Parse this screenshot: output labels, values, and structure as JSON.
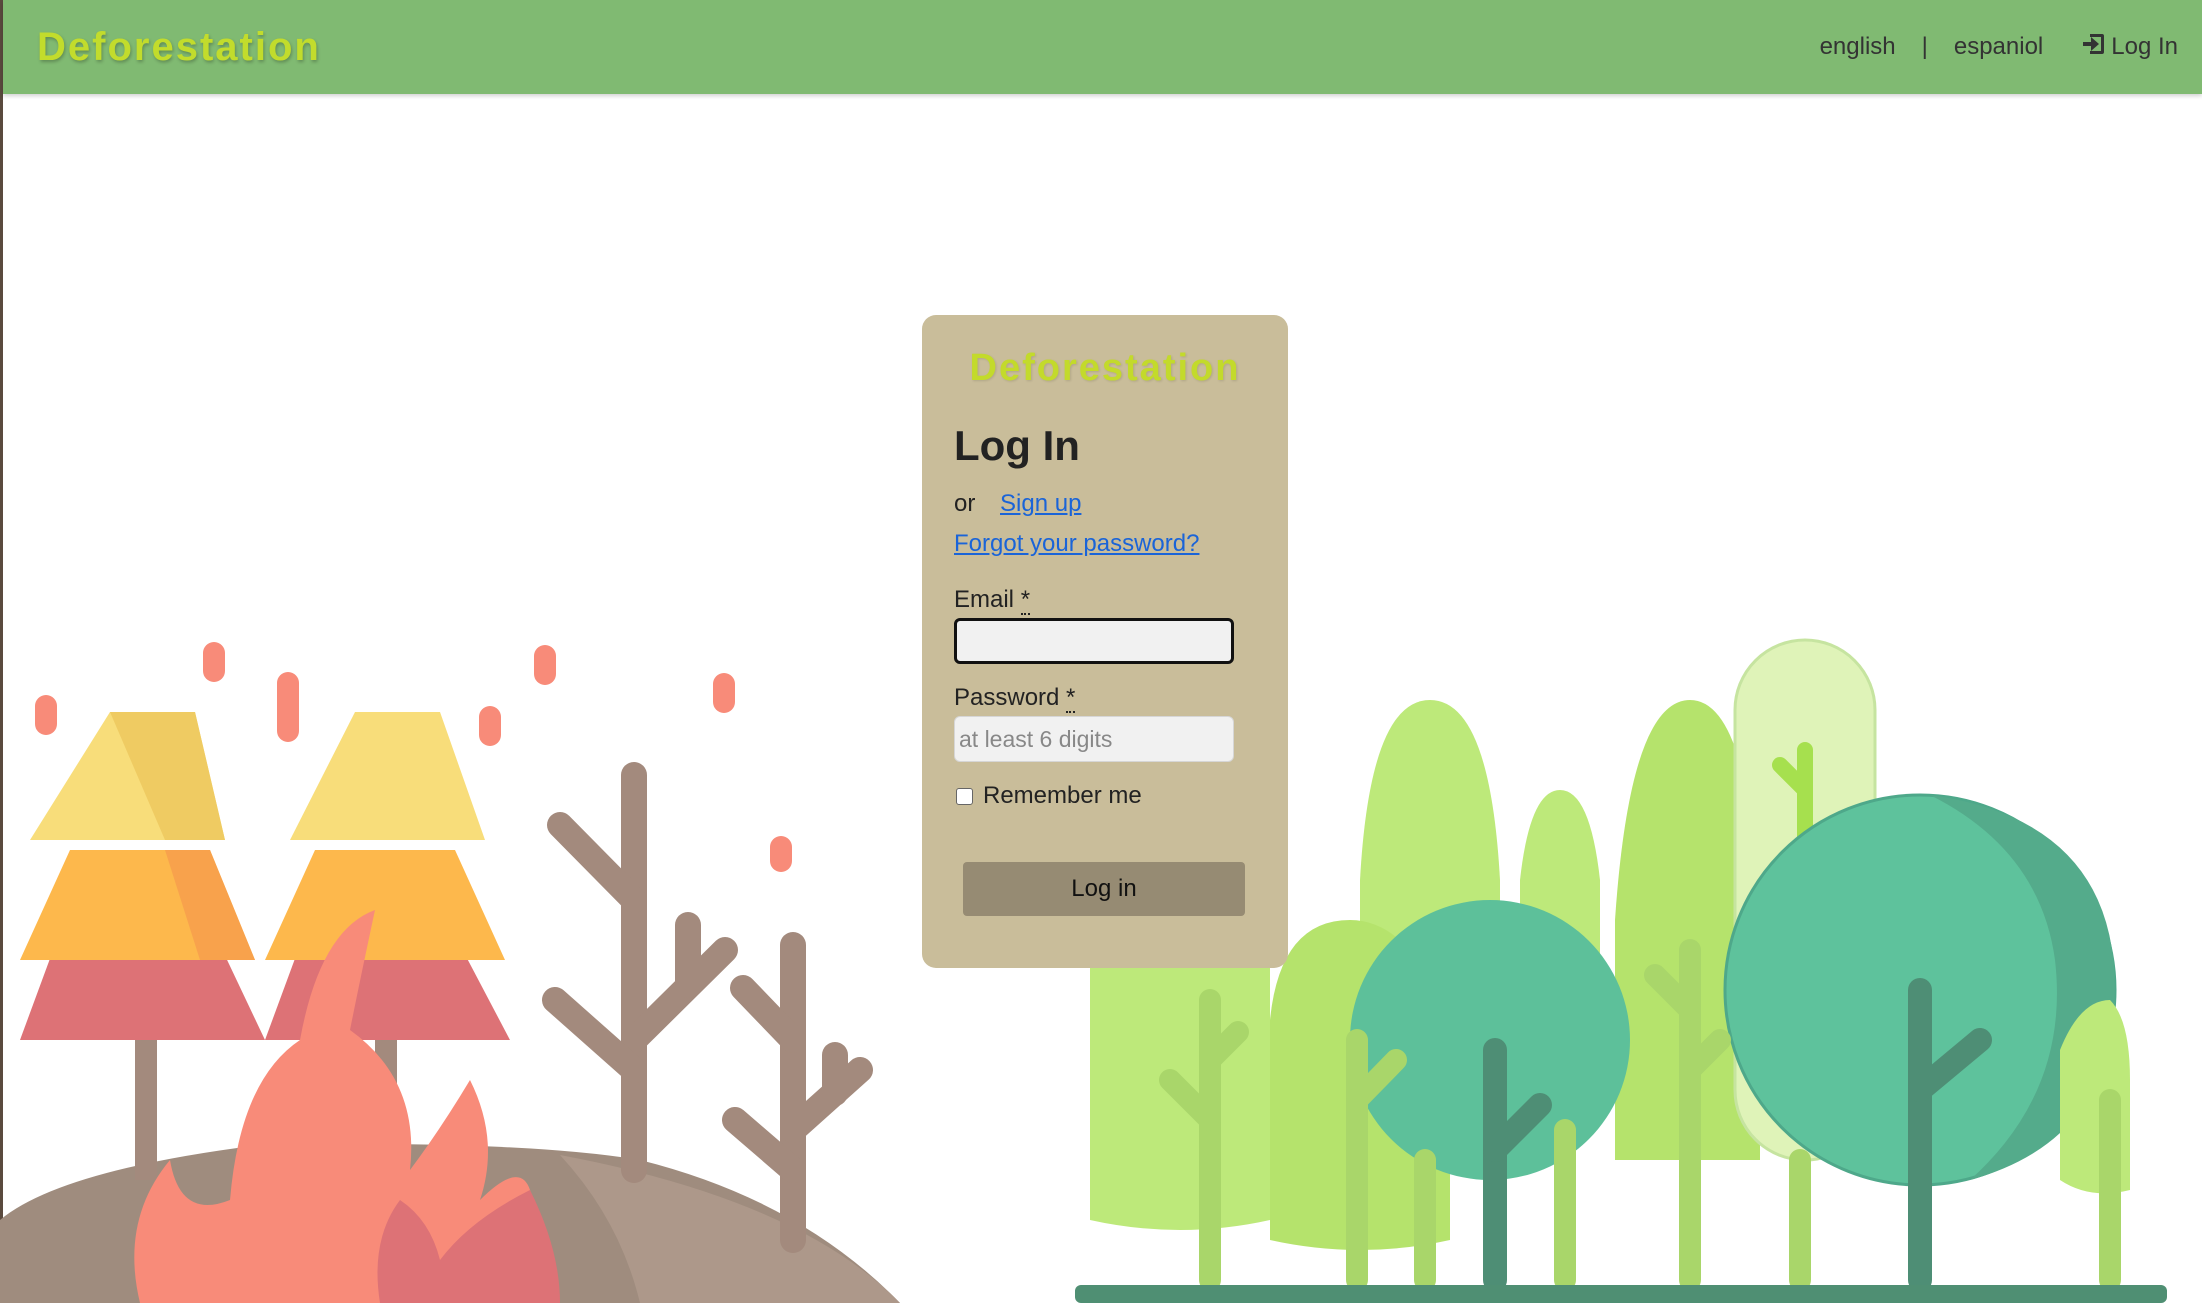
{
  "navbar": {
    "brand": "Deforestation",
    "lang_english": "english",
    "separator": "|",
    "lang_spanish": "espaniol",
    "login_label": "Log In",
    "login_icon": "sign-in-icon",
    "background_color": "#80ba72",
    "brand_color": "#c2dc2c"
  },
  "card": {
    "brand": "Deforestation",
    "title": "Log In",
    "or_text": "or",
    "signup_link": "Sign up",
    "forgot_link": "Forgot your password?",
    "email_label": "Email",
    "required_mark": "*",
    "email_value": "",
    "password_label": "Password",
    "password_placeholder": "at least 6 digits",
    "remember_label": "Remember me",
    "remember_checked": false,
    "submit_label": "Log in",
    "background_color": "#c9bd9a",
    "button_color": "#968b73",
    "link_color": "#1a64d8"
  },
  "illustrations": {
    "left": "burning-forest-illustration",
    "right": "green-forest-illustration"
  }
}
